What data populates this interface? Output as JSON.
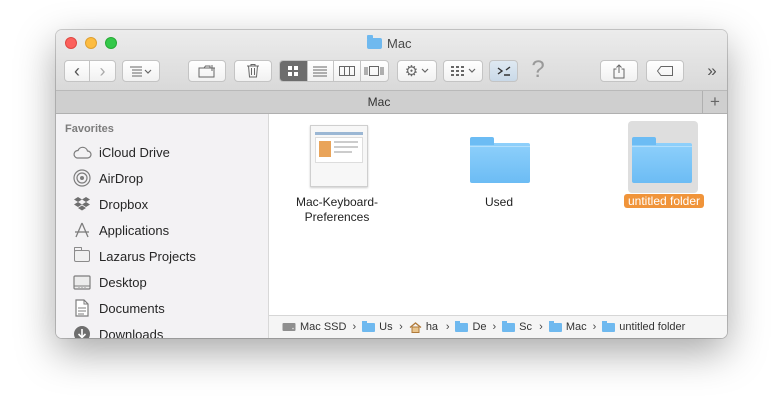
{
  "window": {
    "title": "Mac"
  },
  "toolbar": {
    "back": "‹",
    "forward": "›",
    "help": "?",
    "overflow": "»"
  },
  "tab": {
    "label": "Mac",
    "add": "+"
  },
  "sidebar": {
    "heading": "Favorites",
    "items": [
      {
        "label": "iCloud Drive",
        "icon": "cloud-icon"
      },
      {
        "label": "AirDrop",
        "icon": "airdrop-icon"
      },
      {
        "label": "Dropbox",
        "icon": "dropbox-icon"
      },
      {
        "label": "Applications",
        "icon": "applications-icon"
      },
      {
        "label": "Lazarus Projects",
        "icon": "folder-icon"
      },
      {
        "label": "Desktop",
        "icon": "desktop-icon"
      },
      {
        "label": "Documents",
        "icon": "documents-icon"
      },
      {
        "label": "Downloads",
        "icon": "downloads-icon"
      }
    ]
  },
  "files": [
    {
      "name_line1": "Mac-Keyboard-",
      "name_line2": "Preferences",
      "kind": "image"
    },
    {
      "name_line1": "Used",
      "name_line2": "",
      "kind": "folder"
    },
    {
      "name_line1": "untitled folder",
      "name_line2": "",
      "kind": "folder",
      "selected": true
    }
  ],
  "pathbar": {
    "segments": [
      "Mac SSD",
      "Us",
      "ha",
      "De",
      "Sc",
      "Mac",
      "untitled folder"
    ]
  },
  "colors": {
    "selection_label": "#f0943a",
    "folder_blue": "#6cbcf4"
  }
}
